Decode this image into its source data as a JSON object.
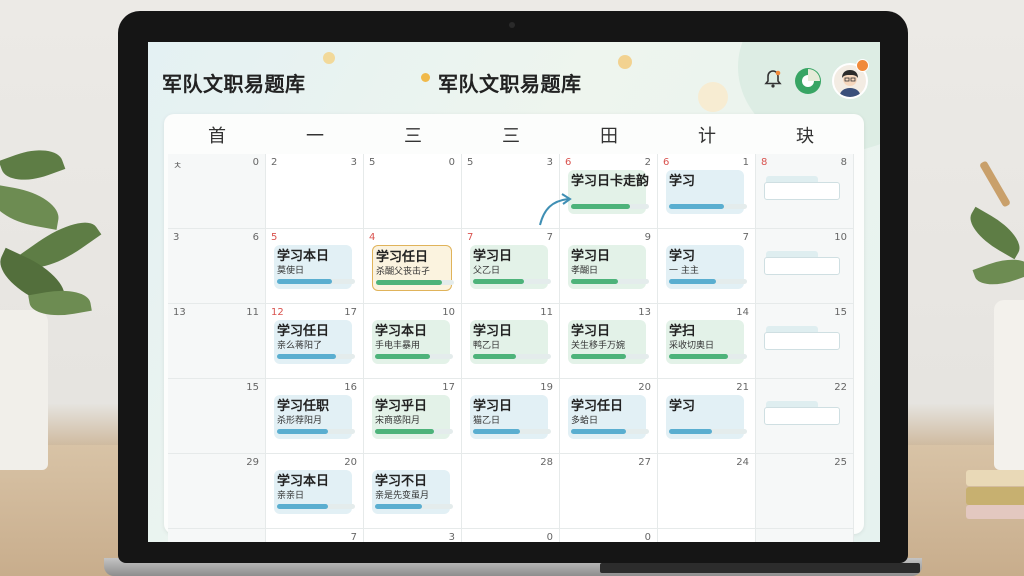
{
  "app": {
    "title_left": "军队文职易题库",
    "title_center": "军队文职易题库"
  },
  "icons": {
    "notification": "bell-icon",
    "progress": "pie-chart-icon",
    "profile": "avatar-icon"
  },
  "colors": {
    "accent_green": "#38a564",
    "accent_blue": "#5aaed0",
    "badge_orange": "#f08a3a",
    "date_red": "#d9534f"
  },
  "calendar": {
    "weekdays": [
      "首",
      "一",
      "三",
      "三",
      "田",
      "计",
      "玦"
    ],
    "rows": [
      [
        {
          "left": "ㅊ",
          "right": "0"
        },
        {
          "left": "2",
          "right": "3"
        },
        {
          "left": "5",
          "right": "0"
        },
        {
          "left": "5",
          "right": "3"
        },
        {
          "left": "6",
          "right": "2",
          "left_red": true,
          "event": {
            "title": "学习日卡走韵",
            "subtitle": "",
            "progress": 0.75,
            "color": "green"
          }
        },
        {
          "left": "6",
          "right": "1",
          "left_red": true,
          "event": {
            "title": "学习",
            "subtitle": "",
            "progress": 0.7,
            "color": "blue"
          }
        },
        {
          "left": "8",
          "right": "8",
          "left_red": true
        }
      ],
      [
        {
          "left": "3",
          "right": "6"
        },
        {
          "left": "5",
          "right": "",
          "left_red": true,
          "event": {
            "title": "学习本日",
            "subtitle": "莫使日",
            "progress": 0.7,
            "color": "blue"
          }
        },
        {
          "left": "4",
          "right": "",
          "left_red": true,
          "event": {
            "title": "学习任日",
            "subtitle": "杀醐父丧击孑",
            "progress": 0.85,
            "color": "green",
            "highlight": true
          }
        },
        {
          "left": "7",
          "right": "7",
          "left_red": true,
          "event": {
            "title": "学习日",
            "subtitle": "父乙日",
            "progress": 0.65,
            "color": "green"
          }
        },
        {
          "left": "",
          "right": "9",
          "event": {
            "title": "学习日",
            "subtitle": "孝醐日",
            "progress": 0.6,
            "color": "green"
          }
        },
        {
          "left": "",
          "right": "7",
          "event": {
            "title": "学习",
            "subtitle": "一 主主",
            "progress": 0.6,
            "color": "blue"
          }
        },
        {
          "left": "",
          "right": "10"
        }
      ],
      [
        {
          "left": "13",
          "right": "11"
        },
        {
          "left": "12",
          "right": "17",
          "left_red": true,
          "event": {
            "title": "学习任日",
            "subtitle": "亲么蒋阳了",
            "progress": 0.75,
            "color": "blue"
          }
        },
        {
          "left": "",
          "right": "10",
          "event": {
            "title": "学习本日",
            "subtitle": "手电丰暴用",
            "progress": 0.7,
            "color": "green"
          }
        },
        {
          "left": "",
          "right": "11",
          "event": {
            "title": "学习日",
            "subtitle": "鸭乙日",
            "progress": 0.55,
            "color": "green"
          }
        },
        {
          "left": "",
          "right": "13",
          "event": {
            "title": "学习日",
            "subtitle": "关生移手万婉",
            "progress": 0.7,
            "color": "green"
          }
        },
        {
          "left": "",
          "right": "14",
          "event": {
            "title": "学扫",
            "subtitle": "采收切奥日",
            "progress": 0.75,
            "color": "green"
          }
        },
        {
          "left": "",
          "right": "15"
        }
      ],
      [
        {
          "left": "",
          "right": "15"
        },
        {
          "left": "",
          "right": "16",
          "event": {
            "title": "学习任职",
            "subtitle": "杀形荐阳月",
            "progress": 0.65,
            "color": "blue"
          }
        },
        {
          "left": "",
          "right": "17",
          "event": {
            "title": "学习乎日",
            "subtitle": "宋商惑阳月",
            "progress": 0.75,
            "color": "green"
          }
        },
        {
          "left": "",
          "right": "19",
          "event": {
            "title": "学习日",
            "subtitle": "猫乙日",
            "progress": 0.6,
            "color": "blue"
          }
        },
        {
          "left": "",
          "right": "20",
          "event": {
            "title": "学习任日",
            "subtitle": "多蛤日",
            "progress": 0.7,
            "color": "blue"
          }
        },
        {
          "left": "",
          "right": "21",
          "event": {
            "title": "学习",
            "subtitle": "",
            "progress": 0.55,
            "color": "blue"
          }
        },
        {
          "left": "",
          "right": "22"
        }
      ],
      [
        {
          "left": "",
          "right": "29"
        },
        {
          "left": "",
          "right": "20",
          "event": {
            "title": "学习本日",
            "subtitle": "亲亲日",
            "progress": 0.65,
            "color": "blue"
          }
        },
        {
          "left": "",
          "right": "",
          "event": {
            "title": "学习不日",
            "subtitle": "亲是先变虽月",
            "progress": 0.6,
            "color": "blue"
          }
        },
        {
          "left": "",
          "right": "28"
        },
        {
          "left": "",
          "right": "27"
        },
        {
          "left": "",
          "right": "24"
        },
        {
          "left": "",
          "right": "25"
        }
      ],
      [
        {
          "left": "",
          "right": ""
        },
        {
          "left": "",
          "right": "7"
        },
        {
          "left": "",
          "right": "3"
        },
        {
          "left": "",
          "right": "0"
        },
        {
          "left": "",
          "right": "0"
        },
        {
          "left": "",
          "right": ""
        },
        {
          "left": "",
          "right": ""
        }
      ]
    ]
  }
}
